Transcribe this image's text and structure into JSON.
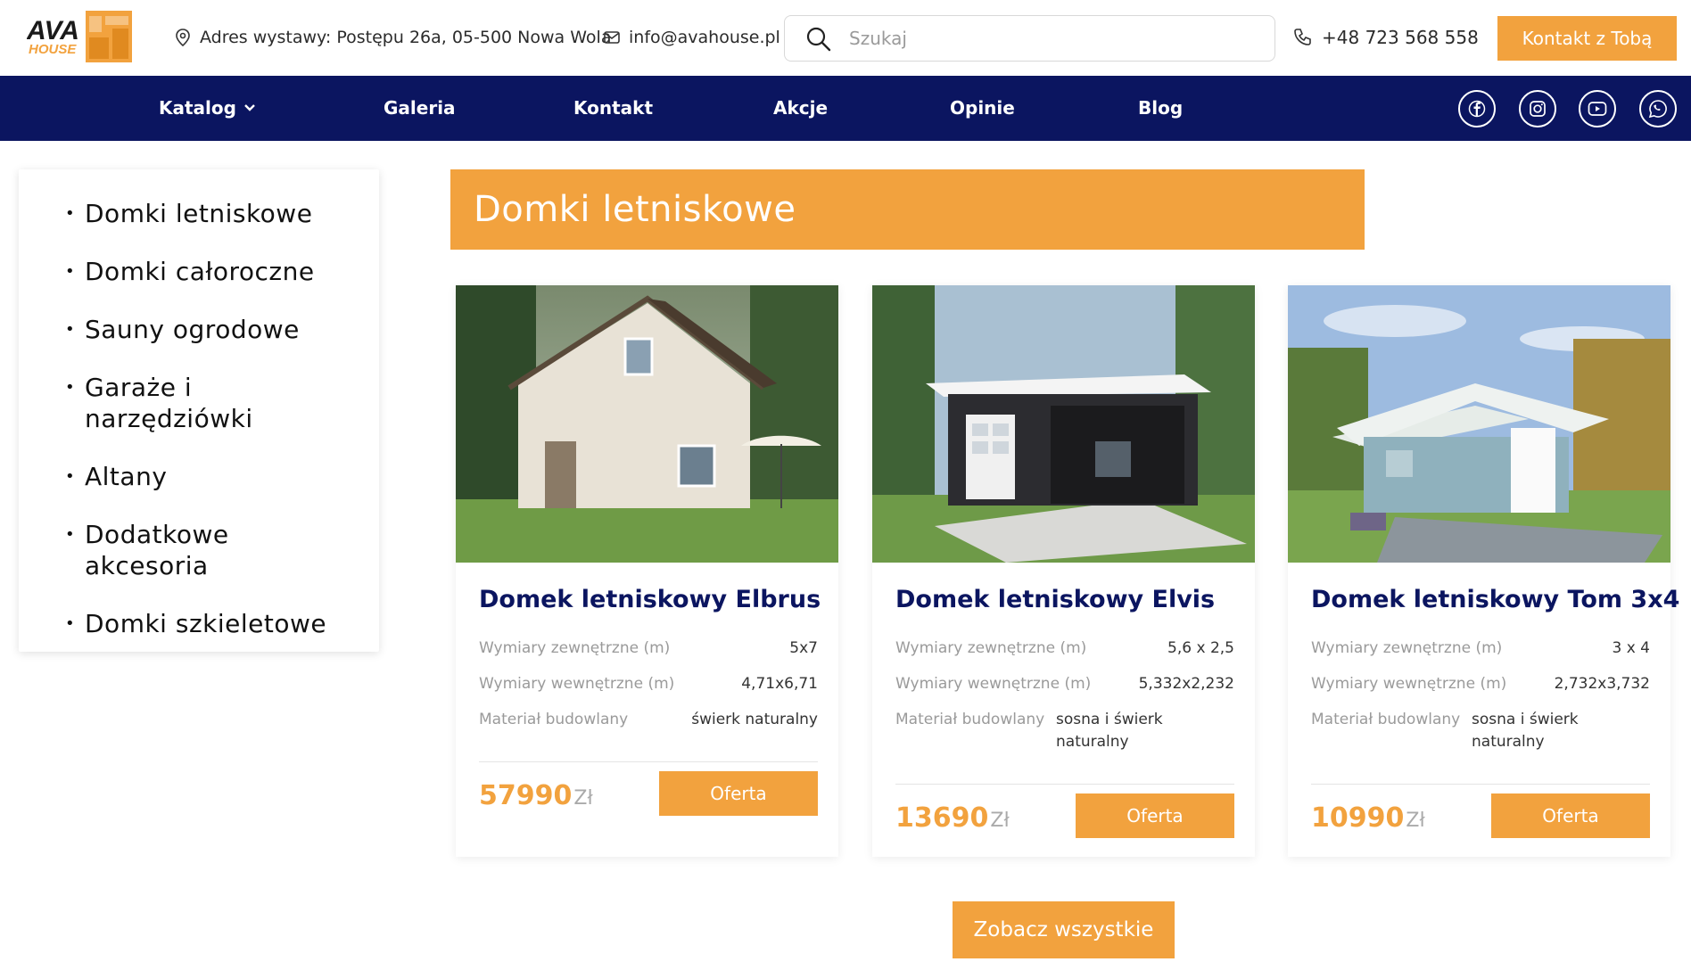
{
  "header": {
    "logo_text_top": "AVA",
    "logo_text_bottom": "HOUSE",
    "address": "Adres wystawy: Postępu 26a, 05-500 Nowa Wola",
    "email": "info@avahouse.pl",
    "search_placeholder": "Szukaj",
    "phone": "+48 723 568 558",
    "contact_button": "Kontakt z Tobą"
  },
  "nav": {
    "items": [
      "Katalog",
      "Galeria",
      "Kontakt",
      "Akcje",
      "Opinie",
      "Blog"
    ],
    "social": [
      "facebook-icon",
      "instagram-icon",
      "youtube-icon",
      "whatsapp-icon"
    ]
  },
  "sidebar": {
    "items": [
      "Domki letniskowe",
      "Domki całoroczne",
      "Sauny ogrodowe",
      "Garaże i narzędziówki",
      "Altany",
      "Dodatkowe akcesoria",
      "Domki szkieletowe"
    ]
  },
  "main": {
    "section_title": "Domki letniskowe",
    "labels": {
      "outer": "Wymiary zewnętrzne (m)",
      "inner": "Wymiary wewnętrzne (m)",
      "material": "Materiał budowlany",
      "currency": "Zł",
      "offer": "Oferta"
    },
    "cards": [
      {
        "title": "Domek letniskowy Elbrus",
        "outer": "5x7",
        "inner": "4,71x6,71",
        "material": "świerk naturalny",
        "price": "57990"
      },
      {
        "title": "Domek letniskowy Elvis",
        "outer": "5,6 x 2,5",
        "inner": "5,332x2,232",
        "material": "sosna i świerk naturalny",
        "price": "13690"
      },
      {
        "title": "Domek letniskowy Tom 3x4",
        "outer": "3 x 4",
        "inner": "2,732x3,732",
        "material": "sosna i świerk naturalny",
        "price": "10990"
      }
    ],
    "see_all": "Zobacz wszystkie"
  },
  "colors": {
    "accent": "#f2a23e",
    "navy": "#0b1560"
  }
}
